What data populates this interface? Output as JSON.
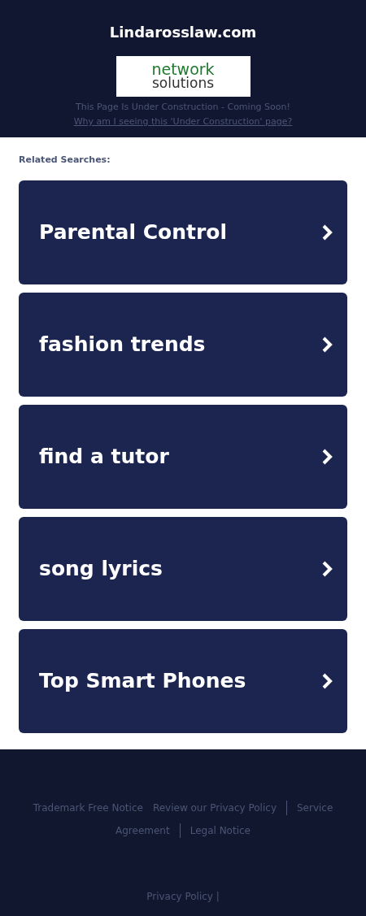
{
  "header": {
    "title": "Lindarosslaw.com",
    "logo": {
      "line_1": "network",
      "line_2": "solutions"
    },
    "notice": "This Page Is Under Construction - Coming Soon!",
    "link": "Why am I seeing this 'Under Construction' page?"
  },
  "related": {
    "heading": "Related Searches:",
    "items": [
      {
        "label": "Parental Control"
      },
      {
        "label": "fashion trends"
      },
      {
        "label": "find a tutor"
      },
      {
        "label": "song lyrics"
      },
      {
        "label": "Top Smart Phones"
      }
    ]
  },
  "footer": {
    "lines": [
      {
        "links": [
          {
            "label": "Trademark Free Notice",
            "divider_before": false
          },
          {
            "label": "Review our Privacy Policy",
            "divider_before": false
          },
          {
            "label": "Service",
            "divider_before": true
          }
        ]
      },
      {
        "links": [
          {
            "label": "Agreement",
            "divider_before": false
          },
          {
            "label": "Legal Notice",
            "divider_before": true
          }
        ]
      }
    ],
    "bottom": "Privacy Policy |"
  }
}
